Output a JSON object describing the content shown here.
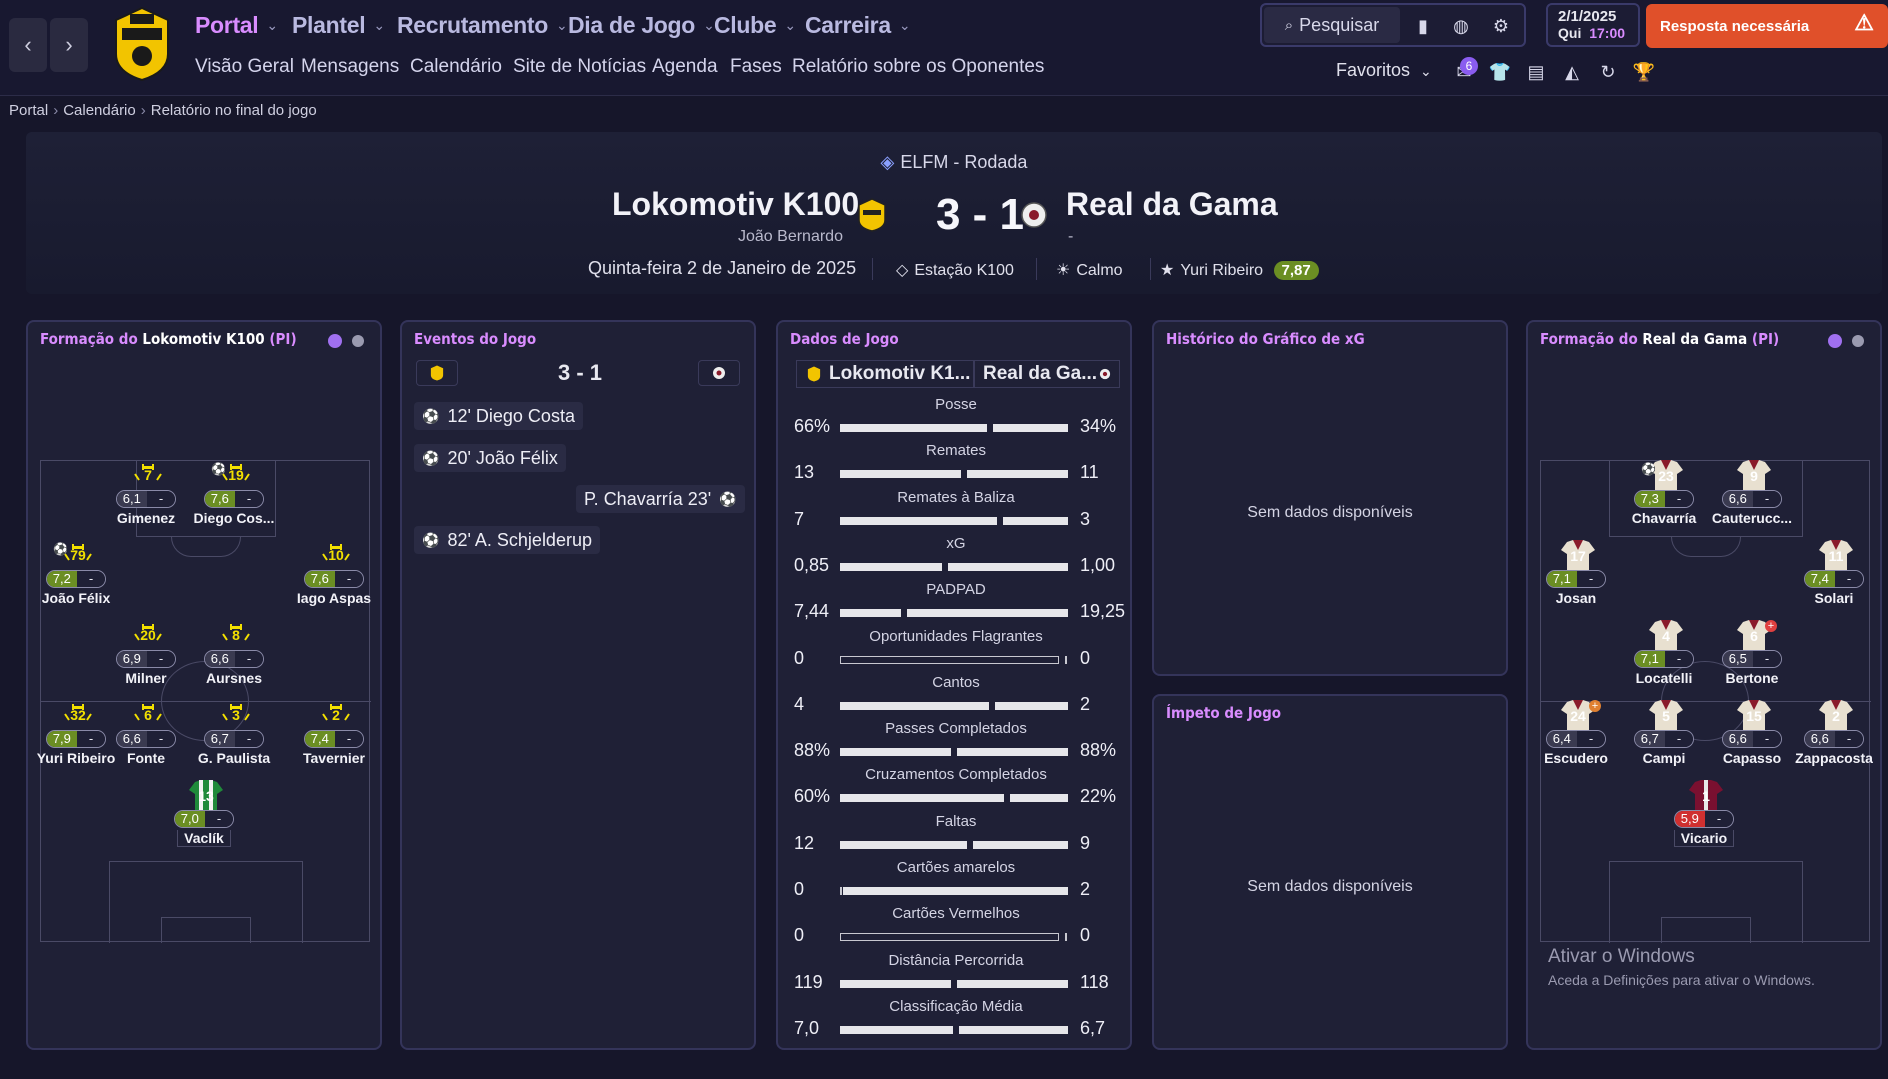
{
  "nav": {
    "back": "‹",
    "forward": "›"
  },
  "menu": [
    {
      "label": "Portal"
    },
    {
      "label": "Plantel"
    },
    {
      "label": "Recrutamento"
    },
    {
      "label": "Dia de Jogo"
    },
    {
      "label": "Clube"
    },
    {
      "label": "Carreira"
    }
  ],
  "submenu": [
    "Visão Geral",
    "Mensagens",
    "Calendário",
    "Site de Notícias",
    "Agenda",
    "Fases",
    "Relatório sobre os Oponentes"
  ],
  "search": {
    "label": "Pesquisar"
  },
  "datetime": {
    "date": "2/1/2025",
    "day": "Qui",
    "time": "17:00"
  },
  "alert": {
    "label": "Resposta necessária"
  },
  "favorites": {
    "label": "Favoritos"
  },
  "badge_count": "6",
  "breadcrumb": [
    "Portal",
    "Calendário",
    "Relatório no final do jogo"
  ],
  "match": {
    "competition": "ELFM - Rodada",
    "home_team": "Lokomotiv K100",
    "home_coach": "João Bernardo",
    "away_team": "Real da Gama",
    "away_coach": "-",
    "score": "3 - 1",
    "date": "Quinta-feira 2 de Janeiro de 2025",
    "stadium": "Estação K100",
    "weather": "Calmo",
    "mvp": "Yuri Ribeiro",
    "mvp_rating": "7,87"
  },
  "home_lineup": {
    "title_prefix": "Formação do",
    "team": "Lokomotiv K100",
    "suffix": "(PI)",
    "players": [
      {
        "num": "7",
        "rating": "6,1",
        "name": "Gimenez",
        "good": false
      },
      {
        "num": "19",
        "rating": "7,6",
        "name": "Diego Cos...",
        "good": true
      },
      {
        "num": "79",
        "rating": "7,2",
        "name": "João Félix",
        "good": true
      },
      {
        "num": "10",
        "rating": "7,6",
        "name": "Iago Aspas",
        "good": true
      },
      {
        "num": "20",
        "rating": "6,9",
        "name": "Milner",
        "good": false
      },
      {
        "num": "8",
        "rating": "6,6",
        "name": "Aursnes",
        "good": false
      },
      {
        "num": "32",
        "rating": "7,9",
        "name": "Yuri Ribeiro",
        "good": true
      },
      {
        "num": "6",
        "rating": "6,6",
        "name": "Fonte",
        "good": false
      },
      {
        "num": "3",
        "rating": "6,7",
        "name": "G. Paulista",
        "good": false
      },
      {
        "num": "2",
        "rating": "7,4",
        "name": "Tavernier",
        "good": true
      },
      {
        "num": "13",
        "rating": "7,0",
        "name": "Vaclík",
        "good": true
      }
    ]
  },
  "away_lineup": {
    "title_prefix": "Formação do",
    "team": "Real da Gama",
    "suffix": "(PI)",
    "players": [
      {
        "num": "23",
        "rating": "7,3",
        "name": "Chavarría",
        "good": true
      },
      {
        "num": "9",
        "rating": "6,6",
        "name": "Cauterucc...",
        "good": false
      },
      {
        "num": "17",
        "rating": "7,1",
        "name": "Josan",
        "good": true
      },
      {
        "num": "11",
        "rating": "7,4",
        "name": "Solari",
        "good": true
      },
      {
        "num": "4",
        "rating": "7,1",
        "name": "Locatelli",
        "good": true
      },
      {
        "num": "6",
        "rating": "6,5",
        "name": "Bertone",
        "good": false
      },
      {
        "num": "24",
        "rating": "6,4",
        "name": "Escudero",
        "good": false
      },
      {
        "num": "5",
        "rating": "6,7",
        "name": "Campi",
        "good": false
      },
      {
        "num": "15",
        "rating": "6,6",
        "name": "Capasso",
        "good": false
      },
      {
        "num": "2",
        "rating": "6,6",
        "name": "Zappacosta",
        "good": false
      },
      {
        "num": "1",
        "rating": "5,9",
        "name": "Vicario",
        "bad": true
      }
    ]
  },
  "events": {
    "title": "Eventos do Jogo",
    "score": "3 - 1",
    "items": [
      {
        "text": "12' Diego Costa",
        "side": "home"
      },
      {
        "text": "20' João Félix",
        "side": "home"
      },
      {
        "text": "P. Chavarría 23'",
        "side": "away"
      },
      {
        "text": "82' A. Schjelderup",
        "side": "home"
      }
    ]
  },
  "stats": {
    "title": "Dados de Jogo",
    "home_short": "Lokomotiv K1...",
    "away_short": "Real da Ga...",
    "rows": [
      {
        "label": "Posse",
        "home": "66%",
        "away": "34%",
        "hv": 66,
        "av": 34
      },
      {
        "label": "Remates",
        "home": "13",
        "away": "11",
        "hv": 13,
        "av": 11
      },
      {
        "label": "Remates à Baliza",
        "home": "7",
        "away": "3",
        "hv": 7,
        "av": 3
      },
      {
        "label": "xG",
        "home": "0,85",
        "away": "1,00",
        "hv": 0.85,
        "av": 1.0
      },
      {
        "label": "PADPAD",
        "home": "7,44",
        "away": "19,25",
        "hv": 7.44,
        "av": 19.25
      },
      {
        "label": "Oportunidades Flagrantes",
        "home": "0",
        "away": "0",
        "hv": 0,
        "av": 0
      },
      {
        "label": "Cantos",
        "home": "4",
        "away": "2",
        "hv": 4,
        "av": 2
      },
      {
        "label": "Passes Completados",
        "home": "88%",
        "away": "88%",
        "hv": 88,
        "av": 88
      },
      {
        "label": "Cruzamentos Completados",
        "home": "60%",
        "away": "22%",
        "hv": 60,
        "av": 22
      },
      {
        "label": "Faltas",
        "home": "12",
        "away": "9",
        "hv": 12,
        "av": 9
      },
      {
        "label": "Cartões amarelos",
        "home": "0",
        "away": "2",
        "hv": 0,
        "av": 2
      },
      {
        "label": "Cartões Vermelhos",
        "home": "0",
        "away": "0",
        "hv": 0,
        "av": 0
      },
      {
        "label": "Distância Percorrida",
        "home": "119",
        "away": "118",
        "hv": 119,
        "av": 118
      },
      {
        "label": "Classificação Média",
        "home": "7,0",
        "away": "6,7",
        "hv": 7.0,
        "av": 6.7
      }
    ]
  },
  "xg": {
    "title": "Histórico do Gráfico de xG",
    "empty": "Sem dados disponíveis"
  },
  "momentum": {
    "title": "Ímpeto de Jogo",
    "empty": "Sem dados disponíveis"
  },
  "watermark": {
    "title": "Ativar o Windows",
    "subtitle": "Aceda a Definições para ativar o Windows."
  },
  "colors": {
    "accent": "#d98cff",
    "good": "#6b8e23",
    "bad": "#d03030",
    "alert": "#e0502a"
  }
}
